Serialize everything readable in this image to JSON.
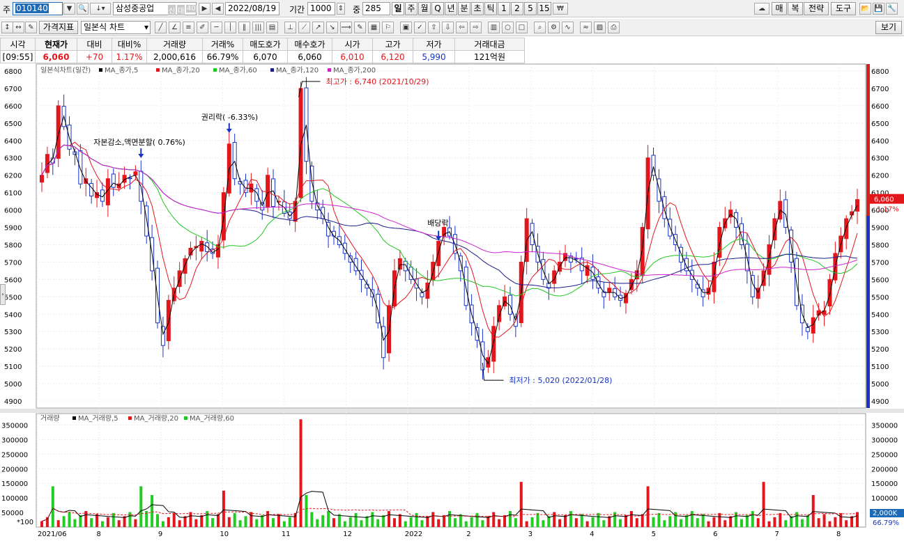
{
  "toolbar1": {
    "prefix_label": "주",
    "code": "010140",
    "name": "삼성중공업",
    "badge_a": "신",
    "badge_b": "대",
    "badge_c": "40",
    "date": "2022/08/19",
    "period_label": "기간",
    "period_value": "1000",
    "middle_label": "중",
    "middle_value": "285",
    "period_buttons": [
      "일",
      "주",
      "월",
      "Q",
      "년",
      "분",
      "초",
      "틱",
      "1",
      "2",
      "5",
      "15"
    ],
    "active_period": "일",
    "right_buttons": [
      "매",
      "복",
      "전략",
      "도구"
    ]
  },
  "toolbar2": {
    "indicator_label": "가격지표",
    "chart_type_value": "일본식 차트",
    "view_button": "보기"
  },
  "quote": {
    "headers": [
      "시각",
      "현재가",
      "대비",
      "대비%",
      "거래량",
      "거래%",
      "매도호가",
      "매수호가",
      "시가",
      "고가",
      "저가",
      "거래대금"
    ],
    "values": [
      "[09:55]",
      "6,060",
      "+70",
      "1.17%",
      "2,000,616",
      "66.79%",
      "6,070",
      "6,060",
      "6,010",
      "6,120",
      "5,990",
      "121억원"
    ]
  },
  "chart_data": {
    "type": "candlestick",
    "price_legend": {
      "title": "일본식차트(일간)",
      "items": [
        {
          "name": "MA_종가,5",
          "color": "#000000"
        },
        {
          "name": "MA_종가,20",
          "color": "#e3161c"
        },
        {
          "name": "MA_종가,60",
          "color": "#1ec81e"
        },
        {
          "name": "MA_종가,120",
          "color": "#1a1a8c"
        },
        {
          "name": "MA_종가,200",
          "color": "#d020d0"
        }
      ]
    },
    "volume_legend": {
      "title": "거래량",
      "items": [
        {
          "name": "MA_거래량,5",
          "color": "#000000"
        },
        {
          "name": "MA_거래량,20",
          "color": "#e3161c"
        },
        {
          "name": "MA_거래량,60",
          "color": "#1ec81e"
        }
      ]
    },
    "price_axis": {
      "min": 4900,
      "max": 6800,
      "step": 100
    },
    "volume_axis": {
      "ticks": [
        50000,
        100000,
        150000,
        200000,
        250000,
        300000,
        350000
      ],
      "unit_label": "*100"
    },
    "x_axis": {
      "labels": [
        "2021/06",
        "8",
        "9",
        "10",
        "11",
        "12",
        "2022",
        "2",
        "3",
        "4",
        "5",
        "6",
        "7",
        "8"
      ]
    },
    "annotations": [
      {
        "text": "최고가 : 6,740 (2021/10/29)",
        "color": "#e3161c"
      },
      {
        "text": "최저가 : 5,020 (2022/01/28)",
        "color": "#1631c8"
      },
      {
        "text": "권리락( -6.33%)",
        "color": "#000000"
      },
      {
        "text": "자본감소,액면분할( 0.76%)",
        "color": "#000000"
      },
      {
        "text": "배당락",
        "color": "#000000"
      }
    ],
    "current": {
      "price": "6,060",
      "pct": "1.17%",
      "volume": "2,000K",
      "volume_pct": "66.79%"
    },
    "high": 6740,
    "low": 5020,
    "close_series": [
      6200,
      6320,
      6270,
      6600,
      6480,
      6350,
      6320,
      6150,
      6180,
      6080,
      6100,
      6050,
      6180,
      6130,
      6150,
      6200,
      6180,
      6220,
      6050,
      5850,
      5650,
      5350,
      5220,
      5480,
      5550,
      5650,
      5720,
      5780,
      5790,
      5820,
      5760,
      5750,
      5800,
      6100,
      6380,
      6180,
      6150,
      6100,
      6150,
      6050,
      6000,
      6200,
      6020,
      6050,
      5980,
      5950,
      6050,
      6700,
      6280,
      6050,
      6000,
      5950,
      5850,
      5850,
      5800,
      5750,
      5700,
      5650,
      5600,
      5550,
      5500,
      5350,
      5150,
      5450,
      5650,
      5720,
      5650,
      5600,
      5550,
      5500,
      5580,
      5700,
      5820,
      5900,
      5850,
      5750,
      5650,
      5450,
      5350,
      5250,
      5080,
      5150,
      5330,
      5450,
      5500,
      5400,
      5330,
      5700,
      5950,
      5800,
      5700,
      5600,
      5550,
      5650,
      5700,
      5750,
      5700,
      5720,
      5650,
      5680,
      5600,
      5550,
      5500,
      5550,
      5500,
      5480,
      5520,
      5600,
      5650,
      5900,
      6300,
      6200,
      6050,
      5950,
      5850,
      5800,
      5700,
      5650,
      5600,
      5550,
      5500,
      5550,
      5700,
      5900,
      5950,
      6000,
      5900,
      5800,
      5650,
      5500,
      5550,
      5650,
      5800,
      5950,
      6050,
      5900,
      5700,
      5450,
      5350,
      5300,
      5380,
      5420,
      5420,
      5600,
      5750,
      5850,
      5950,
      5990,
      6060
    ]
  }
}
